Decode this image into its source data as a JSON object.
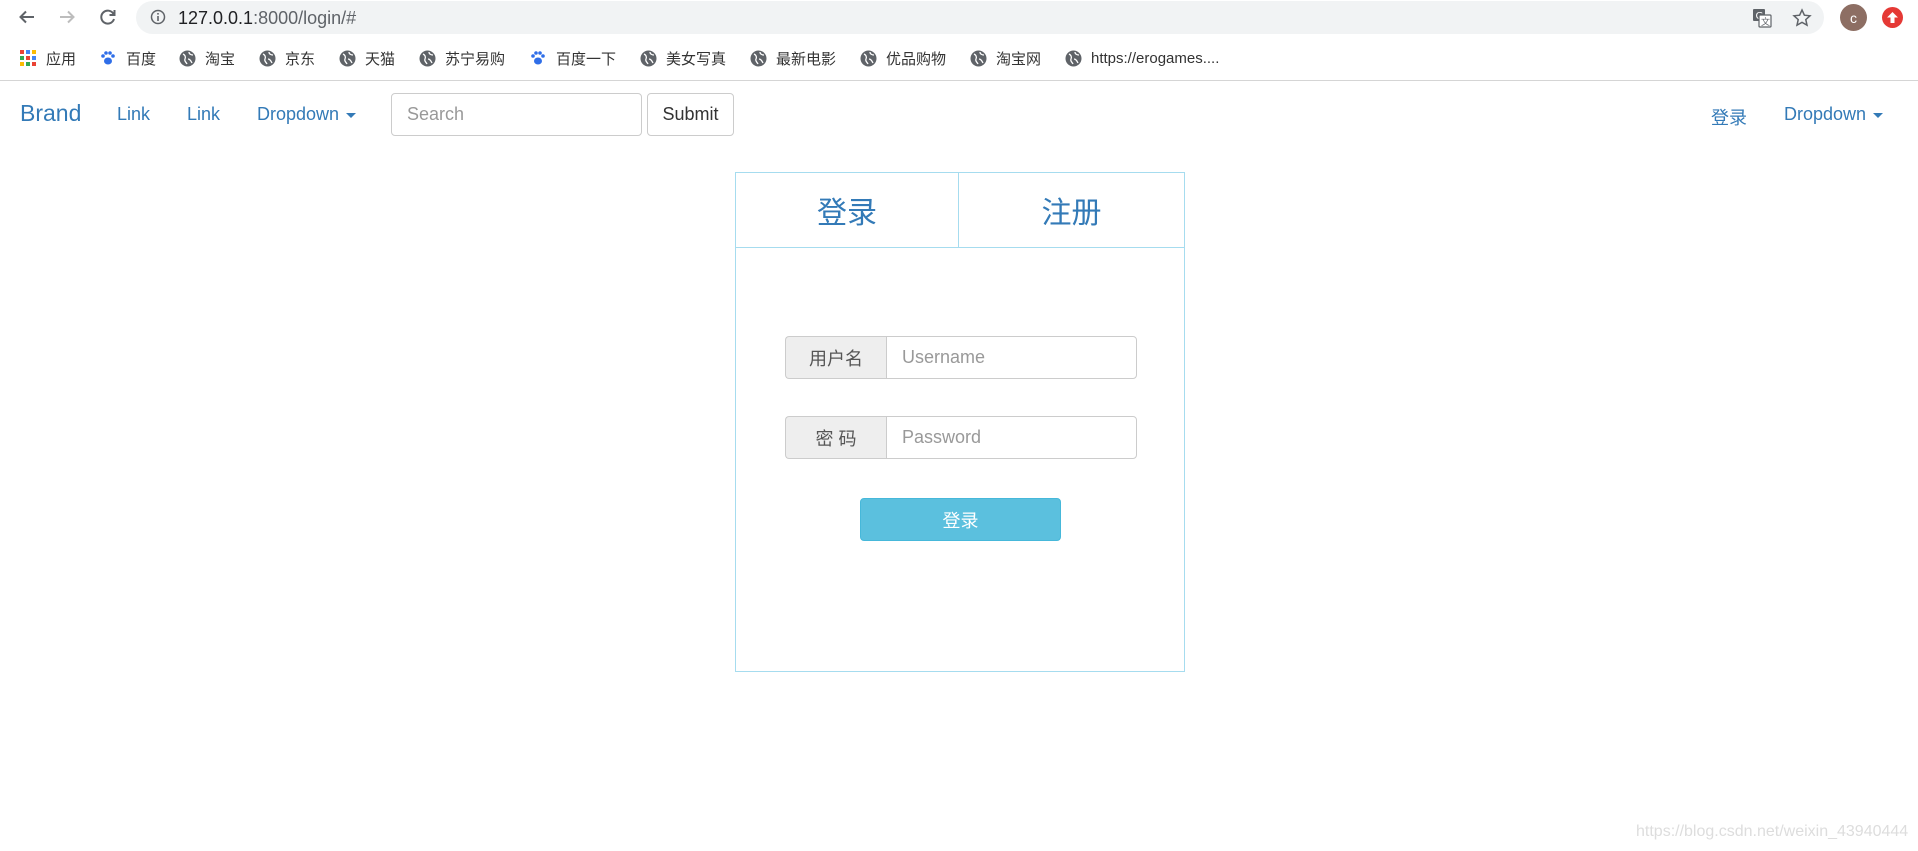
{
  "browser": {
    "url_host": "127.0.0.1",
    "url_path": ":8000/login/#",
    "avatar_letter": "c",
    "icons": {
      "back": "arrow-left-icon",
      "forward": "arrow-right-icon",
      "reload": "reload-icon",
      "site_info": "info-icon",
      "translate": "translate-icon",
      "bookmark_star": "star-icon",
      "extension": "extension-icon"
    }
  },
  "bookmarks": [
    {
      "label": "应用",
      "icon": "apps-grid-icon"
    },
    {
      "label": "百度",
      "icon": "baidu-paw-icon"
    },
    {
      "label": "淘宝",
      "icon": "globe-icon"
    },
    {
      "label": "京东",
      "icon": "globe-icon"
    },
    {
      "label": "天猫",
      "icon": "globe-icon"
    },
    {
      "label": "苏宁易购",
      "icon": "globe-icon"
    },
    {
      "label": "百度一下",
      "icon": "baidu-paw-icon"
    },
    {
      "label": "美女写真",
      "icon": "globe-icon"
    },
    {
      "label": "最新电影",
      "icon": "globe-icon"
    },
    {
      "label": "优品购物",
      "icon": "globe-icon"
    },
    {
      "label": "淘宝网",
      "icon": "globe-icon"
    },
    {
      "label": "https://erogames....",
      "icon": "globe-icon"
    }
  ],
  "navbar": {
    "brand": "Brand",
    "link1": "Link",
    "link2": "Link",
    "dropdown_left": "Dropdown",
    "search_placeholder": "Search",
    "submit": "Submit",
    "login": "登录",
    "dropdown_right": "Dropdown"
  },
  "panel": {
    "tab_login": "登录",
    "tab_register": "注册",
    "username_label": "用户名",
    "username_placeholder": "Username",
    "password_label": "密 码",
    "password_placeholder": "Password",
    "login_button": "登录"
  },
  "watermark": "https://blog.csdn.net/weixin_43940444",
  "colors": {
    "link": "#337ab7",
    "panel_border": "#a6dcef",
    "login_button": "#5bc0de"
  }
}
